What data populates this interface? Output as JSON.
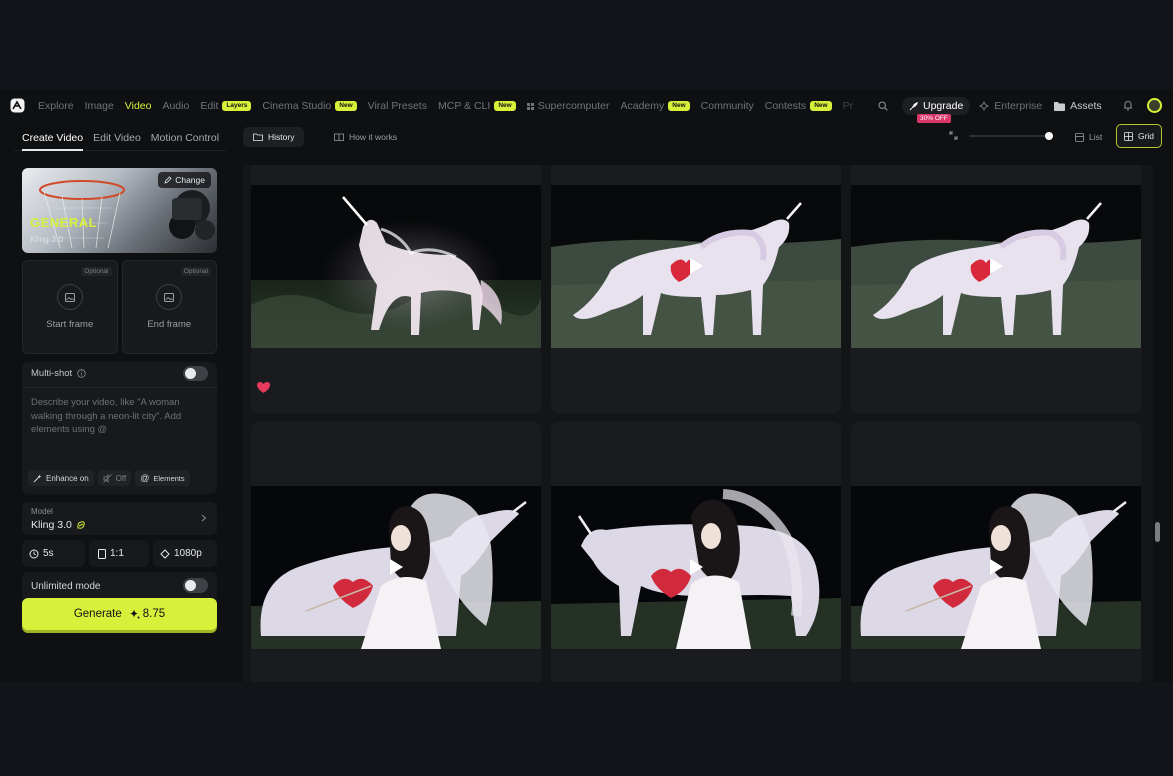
{
  "nav": {
    "items": [
      {
        "label": "Explore",
        "badge": ""
      },
      {
        "label": "Image",
        "badge": ""
      },
      {
        "label": "Video",
        "badge": "",
        "active": true
      },
      {
        "label": "Audio",
        "badge": ""
      },
      {
        "label": "Edit",
        "badge": "Layers"
      },
      {
        "label": "Cinema Studio",
        "badge": "New"
      },
      {
        "label": "Viral Presets",
        "badge": ""
      },
      {
        "label": "MCP & CLI",
        "badge": "New"
      },
      {
        "label": "Supercomputer",
        "badge": ""
      },
      {
        "label": "Academy",
        "badge": "New"
      },
      {
        "label": "Community",
        "badge": ""
      },
      {
        "label": "Contests",
        "badge": "New"
      },
      {
        "label": "Pr",
        "badge": ""
      }
    ],
    "upgrade_label": "Upgrade",
    "upgrade_tag": "30% OFF",
    "enterprise_label": "Enterprise",
    "assets_label": "Assets"
  },
  "sidebar": {
    "tabs": [
      "Create Video",
      "Edit Video",
      "Motion Control"
    ],
    "card": {
      "title": "GENERAL",
      "subtitle": "Kling 3.0",
      "change_label": "Change"
    },
    "start_frame": {
      "label": "Start frame",
      "tag": "Optional"
    },
    "end_frame": {
      "label": "End frame",
      "tag": "Optional"
    },
    "multishot_label": "Multi-shot",
    "prompt_placeholder": "Describe your video, like \"A woman walking through a neon-lit city\". Add elements using @",
    "chips": {
      "enhance": "Enhance on",
      "off": "Off",
      "elements": "Elements"
    },
    "model": {
      "label": "Model",
      "value": "Kling 3.0"
    },
    "options": {
      "duration": "5s",
      "ratio": "1:1",
      "resolution": "1080p"
    },
    "unlimited_label": "Unlimited mode",
    "generate": {
      "label": "Generate",
      "cost": "8.75"
    }
  },
  "main": {
    "tabs": {
      "history": "History",
      "how": "How it works"
    },
    "view": {
      "list": "List",
      "grid": "Grid"
    },
    "zoom_level": 1.0
  },
  "colors": {
    "accent": "#d7f03a",
    "tag": "#d9376a",
    "heart": "#e63a5c"
  }
}
